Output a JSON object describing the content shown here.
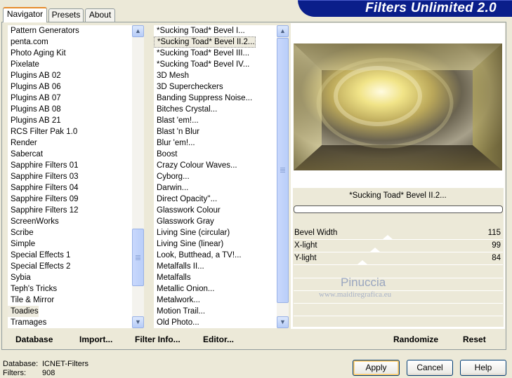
{
  "banner": {
    "title": "Filters Unlimited 2.0"
  },
  "tabs": [
    {
      "label": "Navigator",
      "active": true
    },
    {
      "label": "Presets",
      "active": false
    },
    {
      "label": "About",
      "active": false
    }
  ],
  "categories": {
    "items": [
      "Pattern Generators",
      "penta.com",
      "Photo Aging Kit",
      "Pixelate",
      "Plugins AB 02",
      "Plugins AB 06",
      "Plugins AB 07",
      "Plugins AB 08",
      "Plugins AB 21",
      "RCS Filter Pak 1.0",
      "Render",
      "Sabercat",
      "Sapphire Filters 01",
      "Sapphire Filters 03",
      "Sapphire Filters 04",
      "Sapphire Filters 09",
      "Sapphire Filters 12",
      "ScreenWorks",
      "Scribe",
      "Simple",
      "Special Effects 1",
      "Special Effects 2",
      "Sybia",
      "Teph's Tricks",
      "Tile & Mirror",
      "Toadies",
      "Tramages"
    ],
    "selected": "Toadies"
  },
  "filters": {
    "items": [
      "*Sucking Toad*  Bevel I...",
      "*Sucking Toad*  Bevel II.2...",
      "*Sucking Toad*  Bevel III...",
      "*Sucking Toad*  Bevel IV...",
      "3D Mesh",
      "3D Supercheckers",
      "Banding Suppress Noise...",
      "Bitches Crystal...",
      "Blast 'em!...",
      "Blast 'n Blur",
      "Blur 'em!...",
      "Boost",
      "Crazy Colour Waves...",
      "Cyborg...",
      "Darwin...",
      "Direct Opacity''...",
      "Glasswork Colour",
      "Glasswork Gray",
      "Living Sine (circular)",
      "Living Sine (linear)",
      "Look, Butthead, a TV!...",
      "Metalfalls II...",
      "Metalfalls",
      "Metallic Onion...",
      "Metalwork...",
      "Motion Trail...",
      "Old Photo..."
    ],
    "selected": "*Sucking Toad*  Bevel II.2..."
  },
  "toolbar": {
    "database": "Database",
    "import": "Import...",
    "filter_info": "Filter Info...",
    "editor": "Editor...",
    "randomize": "Randomize",
    "reset": "Reset"
  },
  "current_filter": "*Sucking Toad*  Bevel II.2...",
  "params": [
    {
      "label": "Bevel Width",
      "value": "115",
      "level": 0.45
    },
    {
      "label": "X-light",
      "value": "99",
      "level": 0.39
    },
    {
      "label": "Y-light",
      "value": "84",
      "level": 0.33
    }
  ],
  "watermark": {
    "line1": "Pinuccia",
    "line2": "www.maidiregrafica.eu"
  },
  "footer": {
    "database_label": "Database:",
    "database_value": "ICNET-Filters",
    "filters_label": "Filters:",
    "filters_value": "908",
    "apply": "Apply",
    "cancel": "Cancel",
    "help": "Help"
  }
}
